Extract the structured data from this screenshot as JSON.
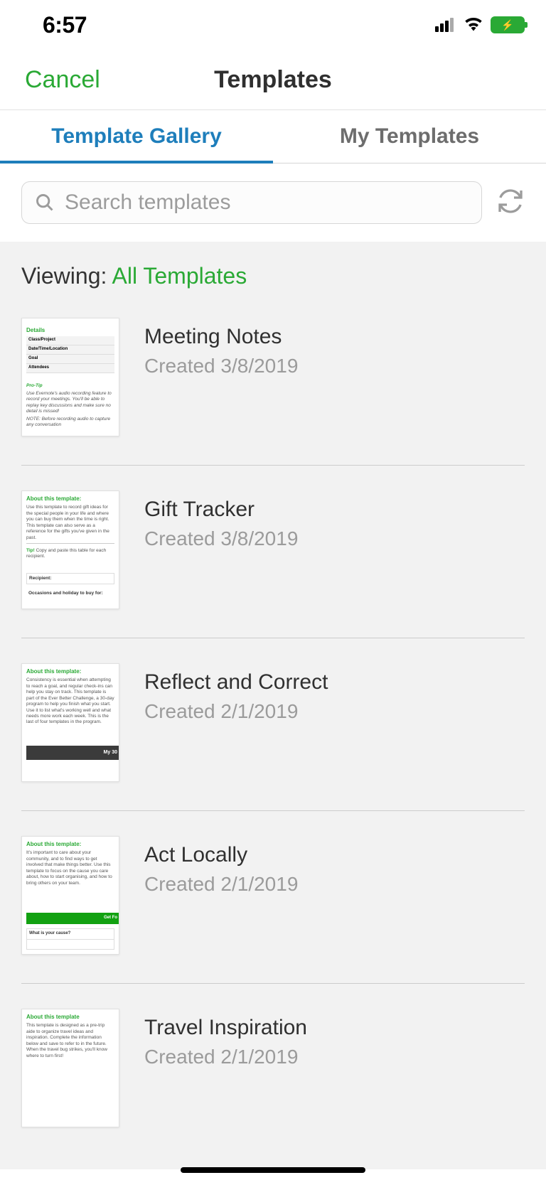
{
  "status": {
    "time": "6:57"
  },
  "nav": {
    "cancel": "Cancel",
    "title": "Templates"
  },
  "tabs": {
    "gallery": "Template Gallery",
    "my": "My Templates"
  },
  "search": {
    "placeholder": "Search templates"
  },
  "viewing": {
    "label": "Viewing: ",
    "value": "All Templates"
  },
  "templates": [
    {
      "title": "Meeting Notes",
      "created": "Created 3/8/2019",
      "thumb": {
        "heading": "Details",
        "rows": [
          "Class/Project",
          "Date/Time/Location",
          "Goal",
          "Attendees"
        ],
        "tipLabel": "Pro-Tip",
        "tipText": "Use Evernote's audio recording feature to record your meetings. You'll be able to replay key discussions and make sure no detail is missed!",
        "note": "NOTE: Before recording audio to capture any conversation"
      }
    },
    {
      "title": "Gift Tracker",
      "created": "Created 3/8/2019",
      "thumb": {
        "heading": "About this template:",
        "body": "Use this template to record gift ideas for the special people in your life and where you can buy them when the time is right. This template can also serve as a reference for the gifts you've given in the past.",
        "tip": "Tip: Copy and paste this table for each recipient.",
        "field1": "Recipient:",
        "field2": "Occasions and holiday to buy for:"
      }
    },
    {
      "title": "Reflect and Correct",
      "created": "Created 2/1/2019",
      "thumb": {
        "heading": "About this template:",
        "body": "Consistency is essential when attempting to reach a goal, and regular check-ins can help you stay on track. This template is part of the Ever Better Challenge, a 30-day program to help you finish what you start. Use it to list what's working well and what needs more work each week. This is the last of four templates in the program.",
        "bar": "My 30"
      }
    },
    {
      "title": "Act Locally",
      "created": "Created 2/1/2019",
      "thumb": {
        "heading": "About this template:",
        "body": "It's important to care about your community, and to find ways to get involved that make things better. Use this template to focus on the cause you care about, how to start organising, and how to bring others on your team.",
        "bar": "Get Fo",
        "q1": "What is your cause?"
      }
    },
    {
      "title": "Travel Inspiration",
      "created": "Created 2/1/2019",
      "thumb": {
        "heading": "About this template",
        "body": "This template is designed as a pre-trip aide to organize travel ideas and inspiration. Complete the information below and save to refer to in the future. When the travel bug strikes, you'll know where to turn first!"
      }
    }
  ]
}
